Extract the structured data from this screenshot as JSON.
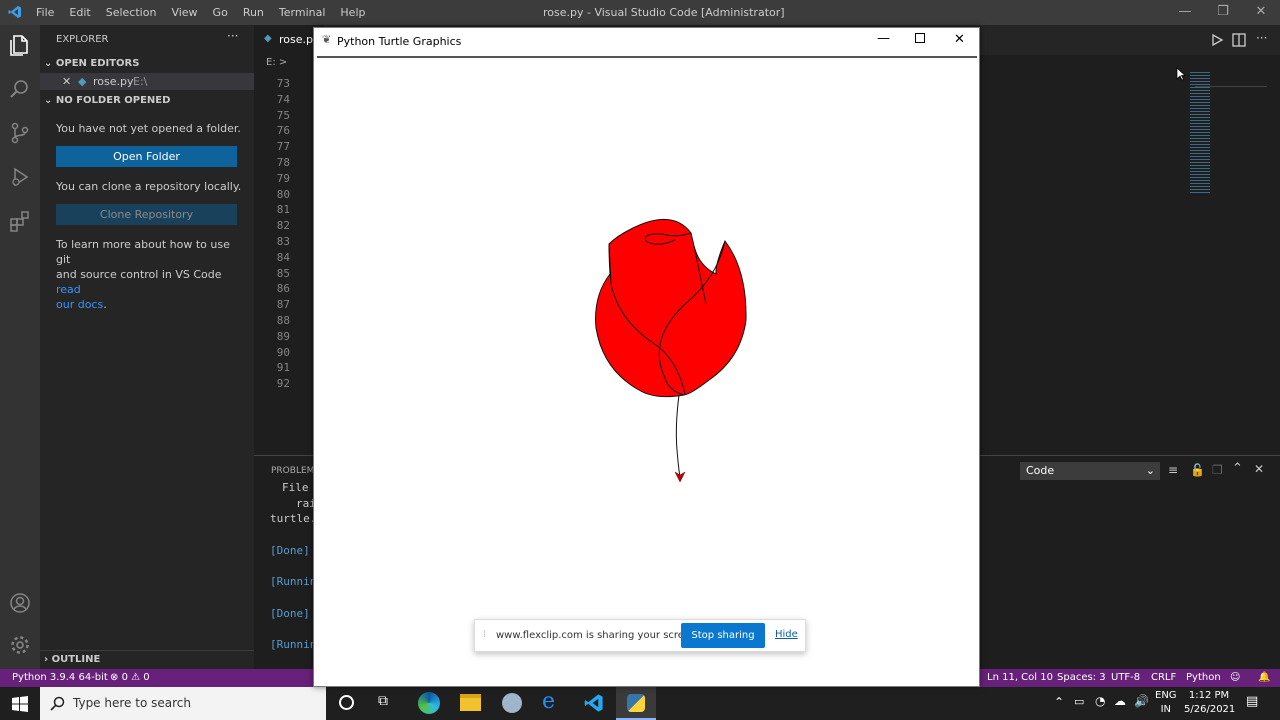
{
  "titlebar": {
    "menus": [
      "File",
      "Edit",
      "Selection",
      "View",
      "Go",
      "Run",
      "Terminal",
      "Help"
    ],
    "title": "rose.py - Visual Studio Code [Administrator]"
  },
  "sidebar": {
    "explorer": "EXPLORER",
    "open_editors": "OPEN EDITORS",
    "file_name": "rose.py",
    "file_path": "E:\\",
    "no_folder": "NO FOLDER OPENED",
    "not_opened": "You have not yet opened a folder.",
    "open_folder": "Open Folder",
    "clone_text": "You can clone a repository locally.",
    "clone_button": "Clone Repository",
    "learn_1": "To learn more about how to use git",
    "learn_2": "and source control in VS Code ",
    "learn_link_1": "read",
    "learn_link_2": "our docs",
    "learn_end": ".",
    "outline": "OUTLINE"
  },
  "editor": {
    "tab": "rose.py",
    "breadcrumb": "E: >",
    "lines": [
      "73",
      "74",
      "75",
      "76",
      "77",
      "78",
      "79",
      "80",
      "81",
      "82",
      "83",
      "84",
      "85",
      "86",
      "87",
      "88",
      "89",
      "90",
      "91",
      "92"
    ]
  },
  "panel": {
    "tab": "PROBLEM",
    "dropdown": "Code",
    "output": [
      "File",
      "rai",
      "turtle.",
      "",
      "[Done]",
      "",
      "[Runnin",
      "",
      "[Done]",
      "",
      "[Runnin"
    ]
  },
  "turtle": {
    "title": "Python Turtle Graphics"
  },
  "sharebar": {
    "message": "www.flexclip.com is sharing your screen.",
    "stop": "Stop sharing",
    "hide": "Hide"
  },
  "statusbar": {
    "python": "Python 3.9.4 64-bit",
    "errors": "0",
    "warnings": "0",
    "position": "Ln 11, Col 10",
    "spaces": "Spaces: 3",
    "encoding": "UTF-8",
    "eol": "CRLF",
    "language": "Python"
  },
  "taskbar": {
    "search_placeholder": "Type here to search",
    "lang1": "ENG",
    "lang2": "IN",
    "time": "1:12 PM",
    "date": "5/26/2021"
  },
  "colors": {
    "accent": "#0e639c",
    "status": "#68217a",
    "rose": "#ff0000"
  }
}
